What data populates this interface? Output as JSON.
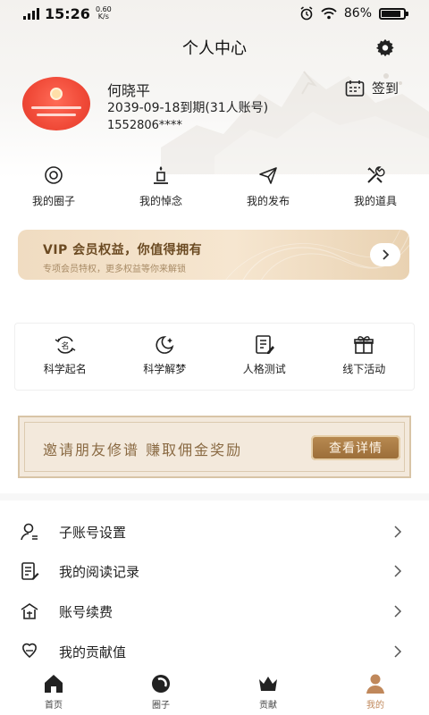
{
  "status_bar": {
    "network": "4G",
    "time": "15:26",
    "speed_value": "0.60",
    "speed_unit": "K/s",
    "battery_percent": "86%",
    "battery_level": 0.86
  },
  "header": {
    "title": "个人中心",
    "settings_icon": "gear-icon"
  },
  "profile": {
    "name": "何晓平",
    "expiry": "2039-09-18到期(31人账号)",
    "phone": "1552806****",
    "signin_label": "签到",
    "signin_icon": "calendar-icon"
  },
  "quick_links": [
    {
      "label": "我的圈子",
      "icon": "circle-icon"
    },
    {
      "label": "我的悼念",
      "icon": "candle-icon"
    },
    {
      "label": "我的发布",
      "icon": "paper-plane-icon"
    },
    {
      "label": "我的道具",
      "icon": "tools-icon"
    }
  ],
  "vip": {
    "title": "VIP  会员权益，你值得拥有",
    "subtitle": "专项会员特权，更多权益等你来解锁"
  },
  "tools": [
    {
      "label": "科学起名",
      "icon": "naming-icon"
    },
    {
      "label": "科学解梦",
      "icon": "moon-icon"
    },
    {
      "label": "人格测试",
      "icon": "test-icon"
    },
    {
      "label": "线下活动",
      "icon": "gift-icon"
    }
  ],
  "invite": {
    "text": "邀请朋友修谱 赚取佣金奖励",
    "button": "查看详情"
  },
  "menu": [
    {
      "label": "子账号设置",
      "icon": "user-settings-icon"
    },
    {
      "label": "我的阅读记录",
      "icon": "reading-icon"
    },
    {
      "label": "账号续费",
      "icon": "renew-icon"
    },
    {
      "label": "我的贡献值",
      "icon": "contribution-icon"
    }
  ],
  "bottom_nav": [
    {
      "label": "首页",
      "icon": "home-icon"
    },
    {
      "label": "圈子",
      "icon": "circle-nav-icon"
    },
    {
      "label": "贡献",
      "icon": "crown-icon"
    },
    {
      "label": "我的",
      "icon": "profile-icon",
      "active": true
    }
  ],
  "colors": {
    "accent": "#c0885b",
    "vip_text": "#6b4a22",
    "invite_text": "#8a6a43",
    "avatar_red": "#f04a38"
  }
}
